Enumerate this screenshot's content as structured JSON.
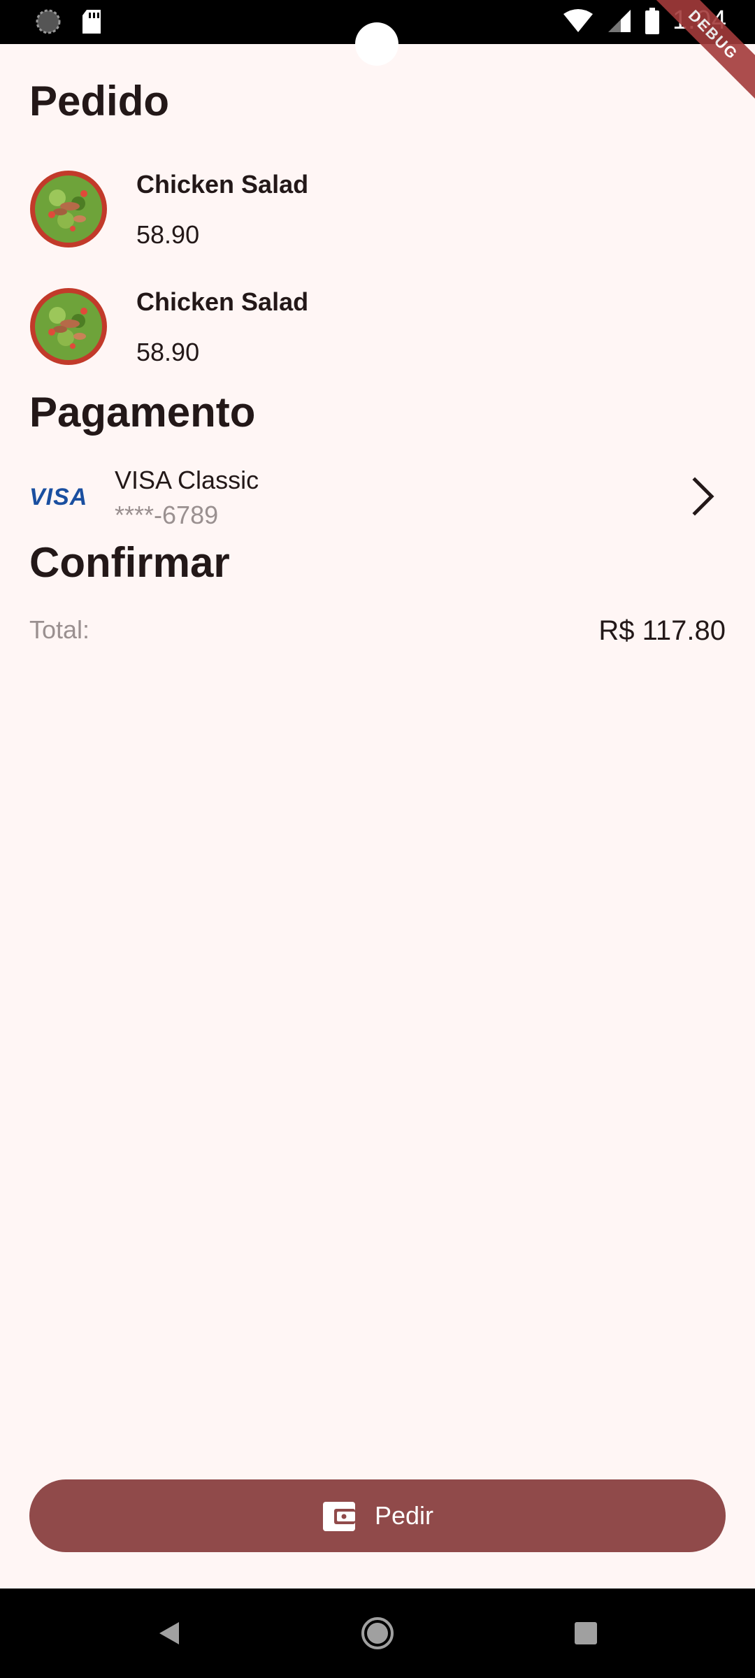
{
  "status_bar": {
    "time": "1:04"
  },
  "debug_label": "DEBUG",
  "order": {
    "title": "Pedido",
    "items": [
      {
        "name": "Chicken Salad",
        "price": "58.90"
      },
      {
        "name": "Chicken Salad",
        "price": "58.90"
      }
    ]
  },
  "payment": {
    "title": "Pagamento",
    "card_brand": "VISA",
    "card_name": "VISA Classic",
    "card_number": "****-6789"
  },
  "confirm": {
    "title": "Confirmar",
    "total_label": "Total:",
    "total_value": "R$ 117.80"
  },
  "order_button": {
    "label": "Pedir"
  },
  "colors": {
    "background": "#fff6f5",
    "primary": "#904a4a",
    "text": "#231818",
    "muted": "#9a9090"
  }
}
